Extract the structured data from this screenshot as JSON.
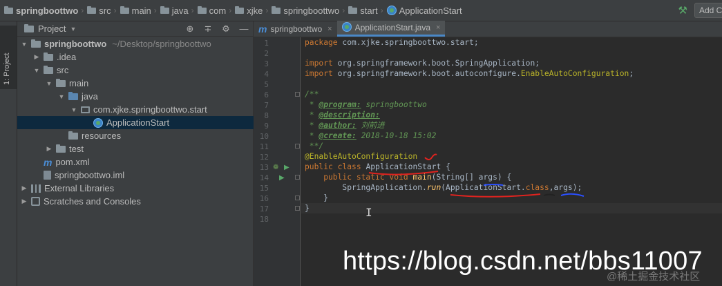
{
  "breadcrumb": [
    {
      "label": "springboottwo",
      "icon": "folder-icon"
    },
    {
      "label": "src",
      "icon": "folder-icon"
    },
    {
      "label": "main",
      "icon": "folder-icon"
    },
    {
      "label": "java",
      "icon": "folder-icon"
    },
    {
      "label": "com",
      "icon": "folder-icon"
    },
    {
      "label": "xjke",
      "icon": "folder-icon"
    },
    {
      "label": "springboottwo",
      "icon": "folder-icon"
    },
    {
      "label": "start",
      "icon": "folder-icon"
    },
    {
      "label": "ApplicationStart",
      "icon": "class-icon"
    }
  ],
  "toolbar": {
    "add_config_label": "Add Co"
  },
  "toolstrip": {
    "project_tab": "1: Project"
  },
  "project_panel": {
    "title": "Project",
    "tree": [
      {
        "label": "springboottwo",
        "path": "~/Desktop/springboottwo",
        "level": 0,
        "arrow": "▼",
        "icon": "folder",
        "bold": true
      },
      {
        "label": ".idea",
        "level": 1,
        "arrow": "▶",
        "icon": "folder"
      },
      {
        "label": "src",
        "level": 1,
        "arrow": "▼",
        "icon": "folder"
      },
      {
        "label": "main",
        "level": 2,
        "arrow": "▼",
        "icon": "folder"
      },
      {
        "label": "java",
        "level": 3,
        "arrow": "▼",
        "icon": "src-folder"
      },
      {
        "label": "com.xjke.springboottwo.start",
        "level": 4,
        "arrow": "▼",
        "icon": "package"
      },
      {
        "label": "ApplicationStart",
        "level": 5,
        "arrow": "",
        "icon": "class",
        "selected": true
      },
      {
        "label": "resources",
        "level": 3,
        "arrow": "",
        "icon": "folder"
      },
      {
        "label": "test",
        "level": 2,
        "arrow": "▶",
        "icon": "folder"
      },
      {
        "label": "pom.xml",
        "level": 1,
        "arrow": "",
        "icon": "maven"
      },
      {
        "label": "springboottwo.iml",
        "level": 1,
        "arrow": "",
        "icon": "iml"
      },
      {
        "label": "External Libraries",
        "level": 0,
        "arrow": "▶",
        "icon": "library"
      },
      {
        "label": "Scratches and Consoles",
        "level": 0,
        "arrow": "▶",
        "icon": "scratch"
      }
    ]
  },
  "tabs": [
    {
      "label": "springboottwo",
      "icon": "maven-icon",
      "active": false
    },
    {
      "label": "ApplicationStart.java",
      "icon": "class-icon",
      "active": true
    }
  ],
  "editor": {
    "line_numbers": [
      "1",
      "2",
      "3",
      "4",
      "5",
      "6",
      "7",
      "8",
      "9",
      "10",
      "11",
      "12",
      "13",
      "14",
      "15",
      "16",
      "17",
      "18"
    ],
    "lines": [
      [
        "package com.xjke.springboottwo.start;"
      ],
      [
        ""
      ],
      [
        "import org.springframework.boot.SpringApplication;"
      ],
      [
        "import org.springframework.boot.autoconfigure.EnableAutoConfiguration;"
      ],
      [
        ""
      ],
      [
        "/**"
      ],
      [
        " * @program: springboottwo"
      ],
      [
        " * @description:"
      ],
      [
        " * @author: 刘前进"
      ],
      [
        " * @create: 2018-10-18 15:02"
      ],
      [
        " **/"
      ],
      [
        "@EnableAutoConfiguration"
      ],
      [
        "public class ApplicationStart {"
      ],
      [
        "    public static void main(String[] args) {"
      ],
      [
        "        SpringApplication.run(ApplicationStart.class,args);"
      ],
      [
        "    }"
      ],
      [
        "}"
      ],
      [
        ""
      ]
    ],
    "tokens": {
      "l1_kw": "package",
      "l1_rest": " com.xjke.springboottwo.start;",
      "l3_kw": "import",
      "l3_rest": " org.springframework.boot.SpringApplication;",
      "l4_kw": "import",
      "l4_rest": " org.springframework.boot.autoconfigure.",
      "l4_cls": "EnableAutoConfiguration",
      "l4_end": ";",
      "l6": "/**",
      "l7_pre": " * ",
      "l7_tag": "@program:",
      "l7_val": " springboottwo",
      "l8_pre": " * ",
      "l8_tag": "@description:",
      "l9_pre": " * ",
      "l9_tag": "@author:",
      "l9_val": " 刘前进",
      "l10_pre": " * ",
      "l10_tag": "@create:",
      "l10_val": " 2018-10-18 15:02",
      "l11": " **/",
      "l12": "@EnableAutoConfiguration",
      "l13_kw": "public class",
      "l13_sp": " ",
      "l13_cls": "ApplicationStart",
      "l13_end": " {",
      "l14_kw": "    public static void",
      "l14_sp": " ",
      "l14_fn": "main",
      "l14_rest": "(String[] args) {",
      "l15_a": "        SpringApplication.",
      "l15_fn": "run",
      "l15_b": "(ApplicationStart.",
      "l15_kw": "class",
      "l15_c": ",args);",
      "l16": "    }",
      "l17": "}"
    }
  },
  "watermark": {
    "url": "https://blog.csdn.net/bbs11007",
    "credit": "@稀土掘金技术社区"
  },
  "colors": {
    "keyword": "#cc7832",
    "comment": "#629755",
    "annotation": "#bbb529",
    "method": "#ffc66d",
    "text": "#a9b7c6",
    "selection": "#0d293e",
    "red_mark": "#e0231f",
    "blue_mark": "#2a4fff"
  }
}
